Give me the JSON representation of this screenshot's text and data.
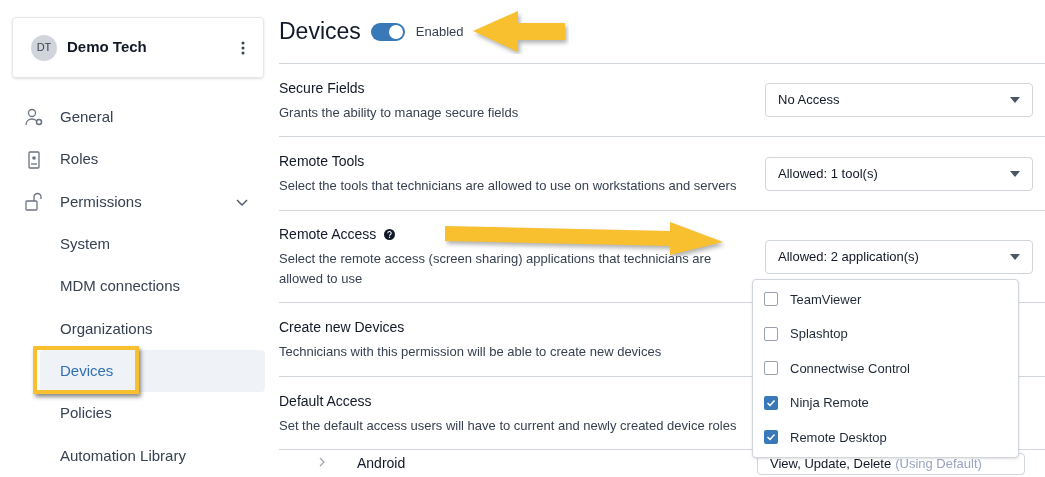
{
  "account": {
    "initials": "DT",
    "name": "Demo Tech"
  },
  "sidebar": {
    "items": [
      {
        "label": "General",
        "selected": false
      },
      {
        "label": "Roles",
        "selected": false
      },
      {
        "label": "Permissions",
        "selected": false,
        "expanded": true,
        "children": [
          {
            "label": "System",
            "selected": false
          },
          {
            "label": "MDM connections",
            "selected": false
          },
          {
            "label": "Organizations",
            "selected": false
          },
          {
            "label": "Devices",
            "selected": true
          },
          {
            "label": "Policies",
            "selected": false
          },
          {
            "label": "Automation Library",
            "selected": false
          }
        ]
      }
    ]
  },
  "header": {
    "title": "Devices",
    "toggle": {
      "on": true,
      "label": "Enabled"
    }
  },
  "sections": [
    {
      "title": "Secure Fields",
      "description": "Grants the ability to manage secure fields",
      "help": false,
      "dropdown": "No Access"
    },
    {
      "title": "Remote Tools",
      "description": "Select the tools that technicians are allowed to use on workstations and servers",
      "help": false,
      "dropdown": "Allowed: 1 tool(s)"
    },
    {
      "title": "Remote Access",
      "description": "Select the remote access (screen sharing) applications that technicians are allowed to use",
      "help": true,
      "dropdown": "Allowed: 2 application(s)",
      "open": true
    },
    {
      "title": "Create new Devices",
      "description": "Technicians with this permission will be able to create new devices",
      "help": false
    },
    {
      "title": "Default Access",
      "description": "Set the default access users will have to current and newly created device roles",
      "help": false
    }
  ],
  "dropdown_menu": {
    "options": [
      {
        "label": "TeamViewer",
        "checked": false
      },
      {
        "label": "Splashtop",
        "checked": false
      },
      {
        "label": "Connectwise Control",
        "checked": false
      },
      {
        "label": "Ninja Remote",
        "checked": true
      },
      {
        "label": "Remote Desktop",
        "checked": true
      }
    ]
  },
  "device_roles": [
    {
      "name": "Android",
      "access": "View, Update, Delete",
      "note": "(Using Default)"
    }
  ]
}
